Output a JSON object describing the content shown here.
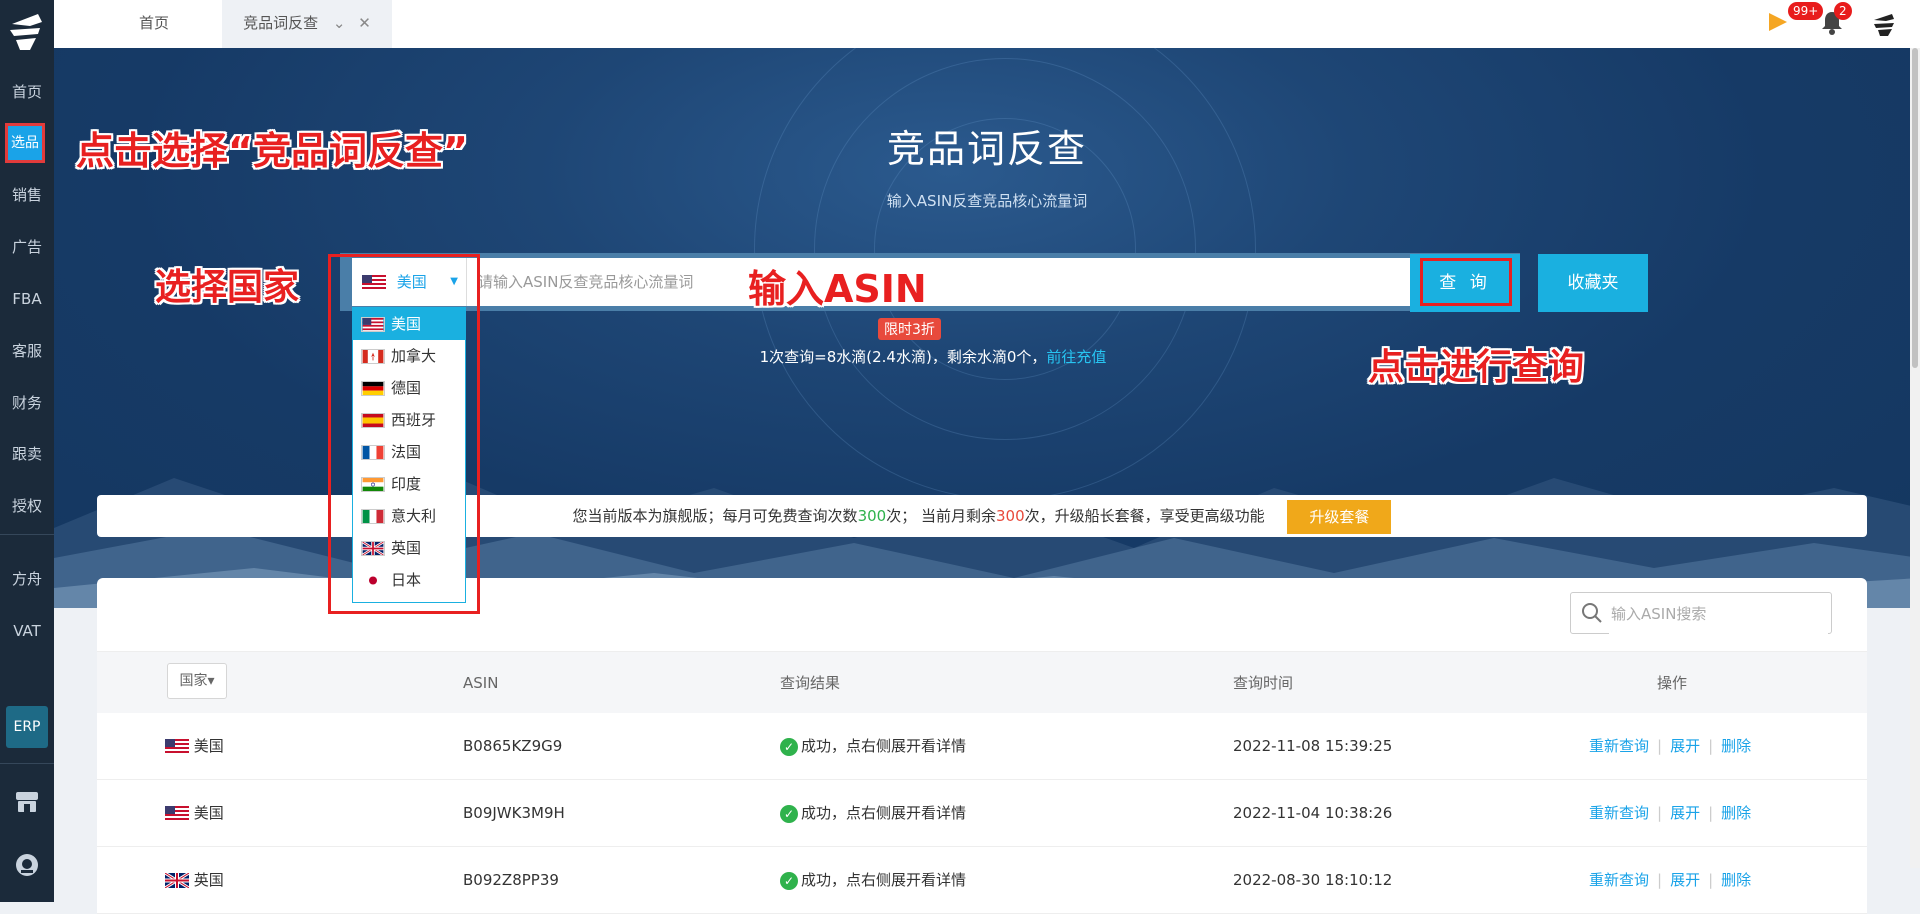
{
  "app": {
    "sidebar_items": [
      "首页",
      "选品",
      "销售",
      "广告",
      "FBA",
      "客服",
      "财务",
      "跟卖",
      "授权",
      "方舟",
      "VAT"
    ],
    "erp_label": "ERP"
  },
  "topbar": {
    "tabs": [
      "首页",
      "竞品词反查"
    ],
    "badges": {
      "flag_count": "99+",
      "bell_count": "2"
    }
  },
  "hero": {
    "title": "竞品词反查",
    "subtitle": "输入ASIN反查竞品核心流量词",
    "country_selected": "美国",
    "search_placeholder": "请输入ASIN反查竞品核心流量词",
    "query_button": "查 询",
    "favorites_button": "收藏夹",
    "promo_tag": "限时3折",
    "promo_text": "1次查询=8水滴(2.4水滴)，剩余水滴0个，",
    "promo_link": "前往充值"
  },
  "country_dropdown": [
    {
      "label": "美国",
      "flag": "us",
      "selected": true
    },
    {
      "label": "加拿大",
      "flag": "ca",
      "selected": false
    },
    {
      "label": "德国",
      "flag": "de",
      "selected": false
    },
    {
      "label": "西班牙",
      "flag": "es",
      "selected": false
    },
    {
      "label": "法国",
      "flag": "fr",
      "selected": false
    },
    {
      "label": "印度",
      "flag": "in",
      "selected": false
    },
    {
      "label": "意大利",
      "flag": "it",
      "selected": false
    },
    {
      "label": "英国",
      "flag": "gb",
      "selected": false
    },
    {
      "label": "日本",
      "flag": "jp",
      "selected": false
    }
  ],
  "plan_bar": {
    "text_a": "您当前版本为旗舰版；每月可免费查询次数",
    "monthly_free": "300",
    "text_b": "次；  当前月剩余",
    "remaining": "300",
    "text_c": "次，升级船长套餐，享受更高级功能",
    "upgrade_button": "升级套餐"
  },
  "table": {
    "search_placeholder": "输入ASIN搜索",
    "headers": {
      "country": "国家▾",
      "asin": "ASIN",
      "result": "查询结果",
      "time": "查询时间",
      "ops": "操作"
    },
    "rows": [
      {
        "country": "美国",
        "flag": "us",
        "asin": "B0865KZ9G9",
        "result": "成功，点右侧展开看详情",
        "time": "2022-11-08 15:39:25"
      },
      {
        "country": "美国",
        "flag": "us",
        "asin": "B09JWK3M9H",
        "result": "成功，点右侧展开看详情",
        "time": "2022-11-04 10:38:26"
      },
      {
        "country": "英国",
        "flag": "gb",
        "asin": "B092Z8PP39",
        "result": "成功，点右侧展开看详情",
        "time": "2022-08-30 18:10:12"
      }
    ],
    "actions": {
      "requery": "重新查询",
      "expand": "展开",
      "delete": "删除"
    }
  },
  "annotations": {
    "click_select": "点击选择“竞品词反查”",
    "select_country": "选择国家",
    "input_asin": "输入ASIN",
    "click_query": "点击进行查询"
  },
  "colors": {
    "accent": "#1ab0e0",
    "annotation": "#e82020",
    "upgrade": "#f0a81a"
  }
}
